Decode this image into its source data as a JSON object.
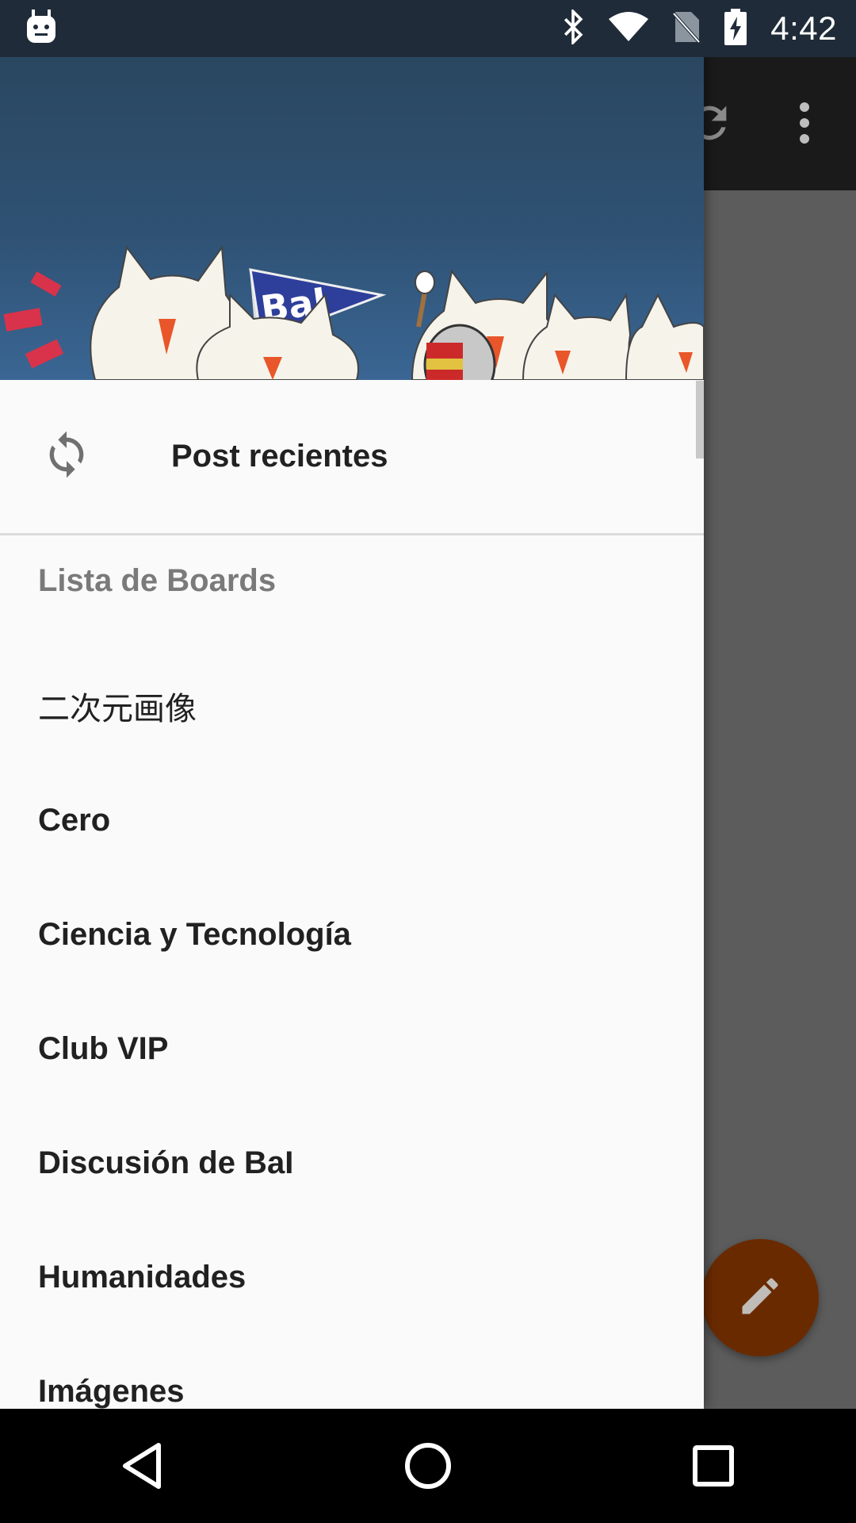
{
  "status_bar": {
    "time": "4:42",
    "icons": [
      "android-notification-icon",
      "bluetooth-icon",
      "wifi-icon",
      "no-sim-icon",
      "battery-charging-icon"
    ]
  },
  "background_app": {
    "toolbar_icons": [
      "refresh-icon",
      "more-vert-icon"
    ],
    "fab_icon": "edit-pencil-icon",
    "fab_color": "#6a2a00"
  },
  "drawer": {
    "header": {
      "flag_text": "BaI",
      "banner_color": "#2f5274"
    },
    "recent": {
      "icon": "sync-icon",
      "label": "Post recientes"
    },
    "section_title": "Lista de Boards",
    "boards": [
      {
        "label": "二次元画像"
      },
      {
        "label": "Cero"
      },
      {
        "label": "Ciencia y Tecnología"
      },
      {
        "label": "Club VIP"
      },
      {
        "label": "Discusión de BaI"
      },
      {
        "label": "Humanidades"
      },
      {
        "label": "Imágenes"
      }
    ]
  },
  "nav_bar": {
    "buttons": [
      "back-icon",
      "home-icon",
      "recents-icon"
    ]
  }
}
